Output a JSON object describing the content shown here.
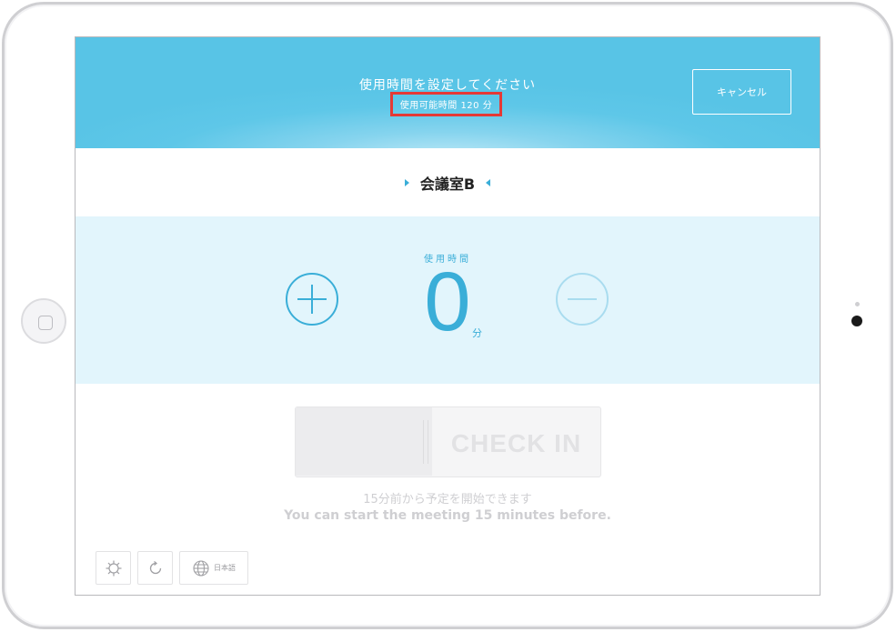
{
  "header": {
    "title": "使用時間を設定してください",
    "subtitle": "使用可能時間 120 分",
    "cancel_label": "キャンセル"
  },
  "room": {
    "name": "会議室B"
  },
  "timer": {
    "label": "使用時間",
    "value": "0",
    "unit": "分"
  },
  "checkin": {
    "label": "CHECK IN"
  },
  "notes": {
    "ja": "15分前から予定を開始できます",
    "en": "You can start the meeting 15 minutes before."
  },
  "toolbar": {
    "language_label": "日本語"
  },
  "colors": {
    "accent": "#3aaed8",
    "header_bg": "#5ec7e8",
    "panel_bg": "#e2f5fc",
    "highlight": "#e53935"
  },
  "icons": {
    "settings": "gear-icon",
    "refresh": "refresh-icon",
    "language": "globe-icon",
    "increase": "plus-circle-icon",
    "decrease": "minus-circle-icon"
  }
}
